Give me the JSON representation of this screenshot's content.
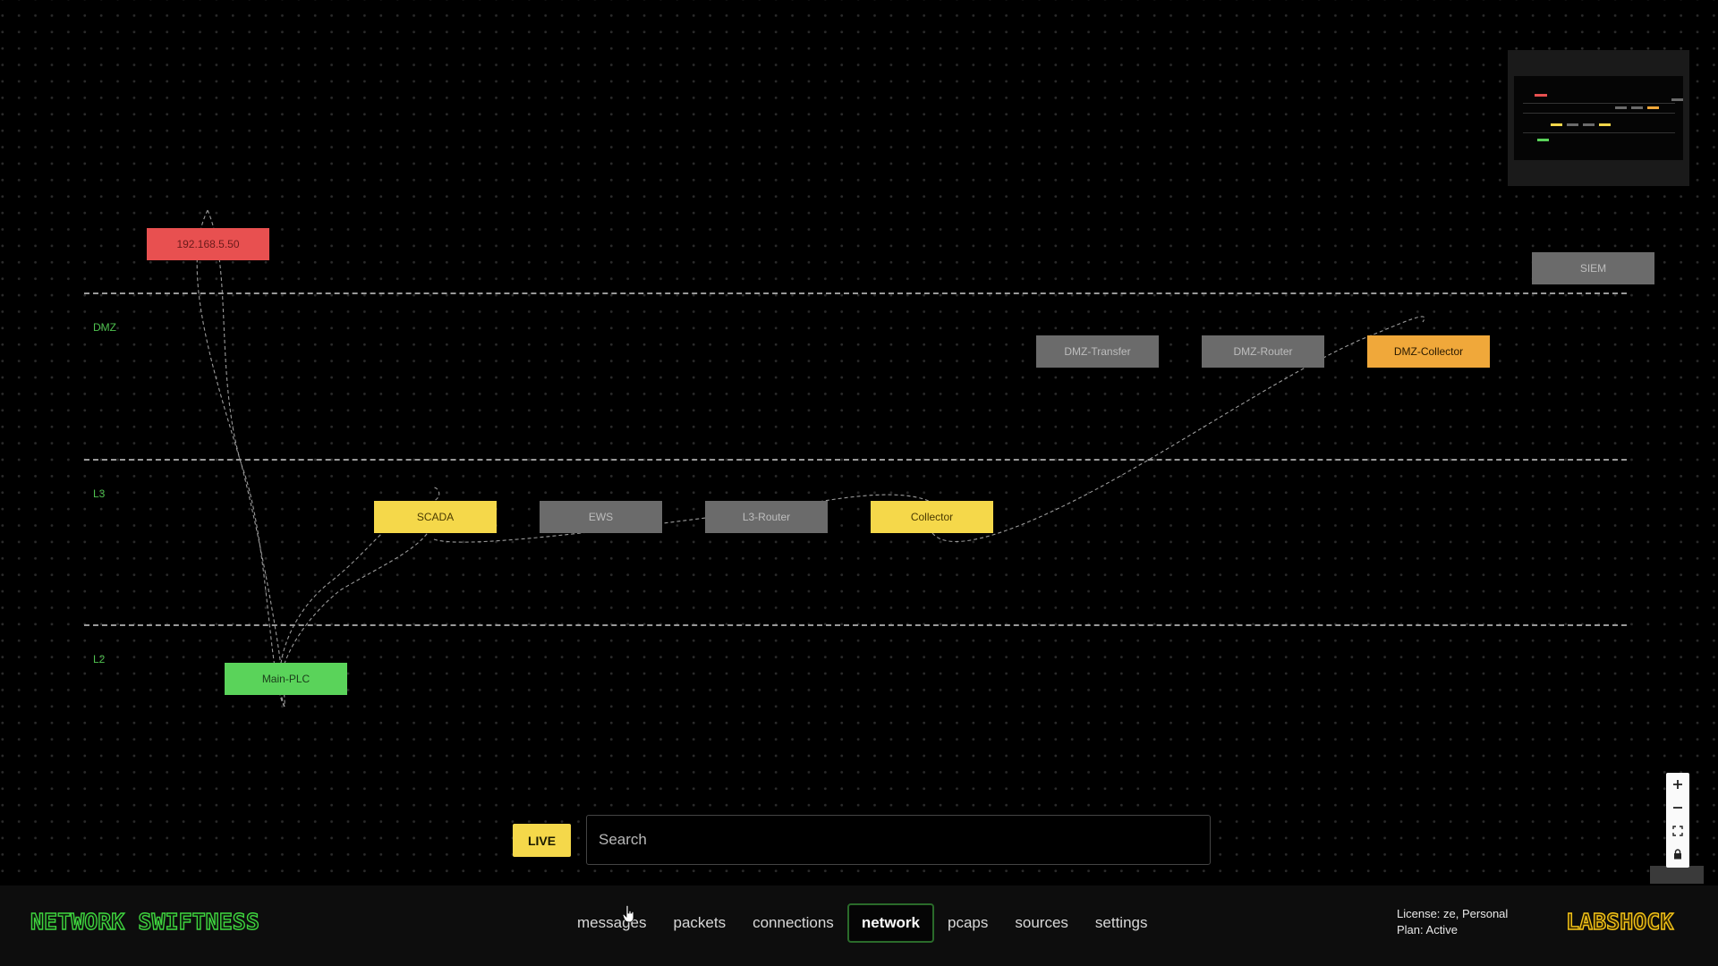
{
  "zones": [
    {
      "id": "dmz",
      "label": "DMZ"
    },
    {
      "id": "l3",
      "label": "L3"
    },
    {
      "id": "l2",
      "label": "L2"
    }
  ],
  "nodes": {
    "ip": {
      "label": "192.168.5.50",
      "color": "#e85050"
    },
    "siem": {
      "label": "SIEM",
      "color": "#6b6b6b"
    },
    "dmz_transfer": {
      "label": "DMZ-Transfer",
      "color": "#6b6b6b"
    },
    "dmz_router": {
      "label": "DMZ-Router",
      "color": "#6b6b6b"
    },
    "dmz_collector": {
      "label": "DMZ-Collector",
      "color": "#f0a83a"
    },
    "scada": {
      "label": "SCADA",
      "color": "#f5d84a"
    },
    "ews": {
      "label": "EWS",
      "color": "#6b6b6b"
    },
    "l3_router": {
      "label": "L3-Router",
      "color": "#6b6b6b"
    },
    "collector": {
      "label": "Collector",
      "color": "#f5d84a"
    },
    "main_plc": {
      "label": "Main-PLC",
      "color": "#5ad35a"
    }
  },
  "controls": {
    "zoom_in_icon": "plus-icon",
    "zoom_out_icon": "minus-icon",
    "fit_icon": "fit-view-icon",
    "lock_icon": "lock-icon"
  },
  "search": {
    "live_label": "LIVE",
    "placeholder": "Search"
  },
  "footer": {
    "brand": "NETWORK SWIFTNESS",
    "nav": [
      {
        "label": "messages",
        "active": false
      },
      {
        "label": "packets",
        "active": false
      },
      {
        "label": "connections",
        "active": false
      },
      {
        "label": "network",
        "active": true
      },
      {
        "label": "pcaps",
        "active": false
      },
      {
        "label": "sources",
        "active": false
      },
      {
        "label": "settings",
        "active": false
      }
    ],
    "license_line": "License: ze, Personal",
    "plan_line": "Plan: Active",
    "partner_logo": "LABSHOCK"
  },
  "colors": {
    "brand_green": "#3fd43f",
    "live_yellow": "#f5d84a",
    "labshock_yellow": "#f5c518"
  }
}
